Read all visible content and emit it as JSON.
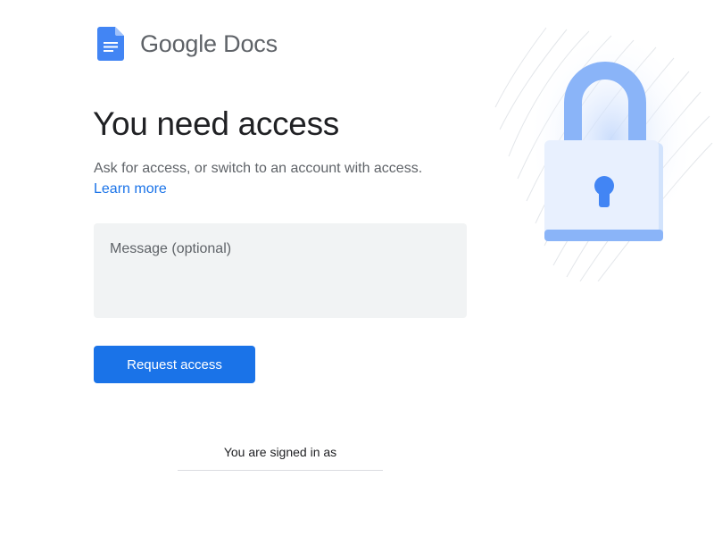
{
  "header": {
    "product_name": "Google Docs",
    "icon": "google-docs-icon"
  },
  "main": {
    "headline": "You need access",
    "subtext": "Ask for access, or switch to an account with access.",
    "learn_more_label": "Learn more",
    "message_placeholder": "Message (optional)",
    "message_value": "",
    "request_button_label": "Request access"
  },
  "footer": {
    "signed_in_label": "You are signed in as"
  },
  "illustration": {
    "icon": "padlock-icon"
  },
  "colors": {
    "accent": "#1a73e8",
    "docs_blue": "#4285f4",
    "input_bg": "#f1f3f4",
    "lock_light": "#e8f0fe",
    "lock_shackle": "#8ab4f8"
  }
}
